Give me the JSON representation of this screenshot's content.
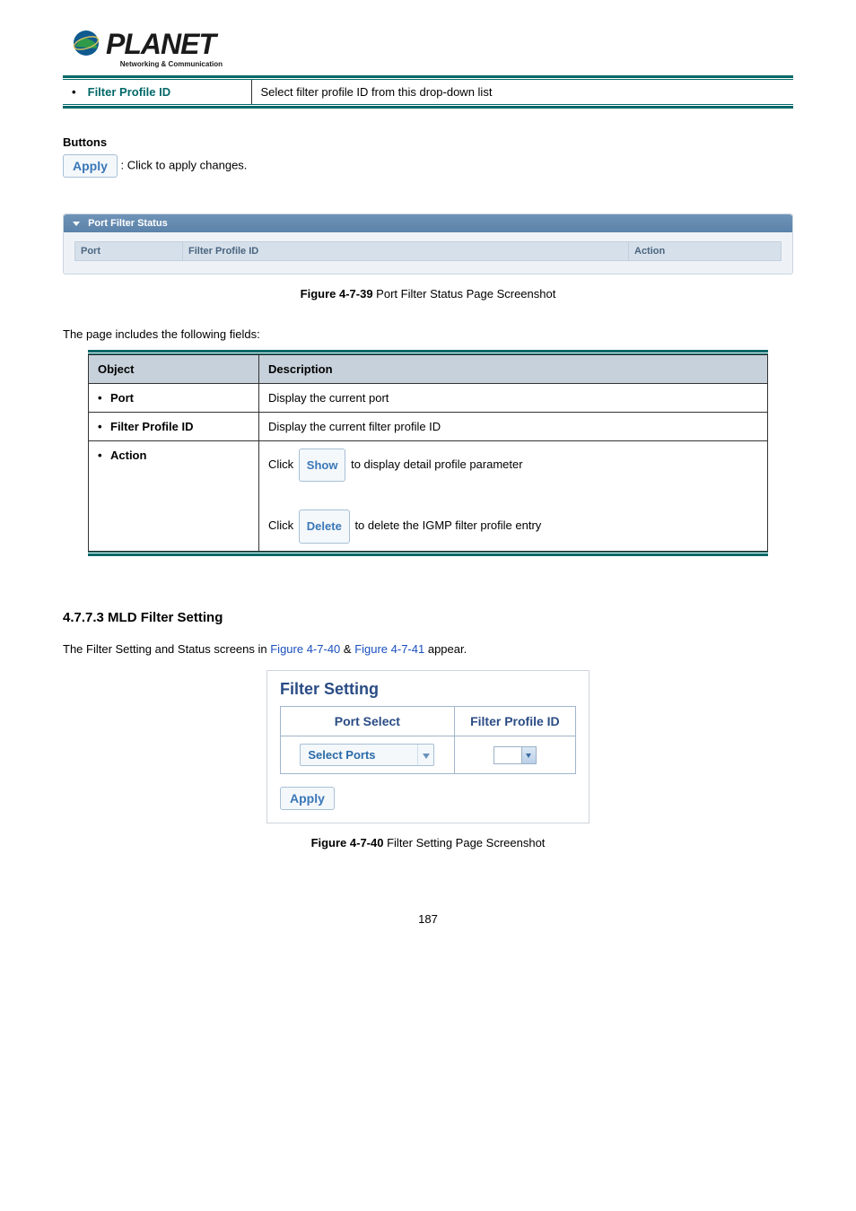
{
  "brand": {
    "name": "PLANET",
    "tagline": "Networking & Communication"
  },
  "param_row": {
    "object": "Filter Profile ID",
    "desc": "Select filter profile ID from this drop-down list"
  },
  "buttons_section": {
    "heading": "Buttons",
    "apply_label": "Apply",
    "apply_desc": ": Click to apply changes."
  },
  "panel": {
    "title": "Port Filter Status",
    "columns": {
      "port": "Port",
      "filter": "Filter Profile ID",
      "action": "Action"
    }
  },
  "fig39": {
    "label": "Figure 4-7-39",
    "caption": " Port Filter Status Page Screenshot"
  },
  "fields_intro": "The page includes the following fields:",
  "fields_table": {
    "head": {
      "obj": "Object",
      "desc": "Description"
    },
    "rows": {
      "port": {
        "obj": "Port",
        "desc": "Display the current port"
      },
      "filter": {
        "obj": "Filter Profile ID",
        "desc": "Display the current filter profile ID"
      },
      "action": {
        "obj": "Action",
        "click": "Click ",
        "show_btn": "Show",
        "show_tail": " to display detail profile parameter",
        "delete_btn": "Delete",
        "delete_tail": " to delete the IGMP filter profile entry"
      }
    }
  },
  "subsection": {
    "num": "4.7.7.3 ",
    "title": "MLD Filter Setting"
  },
  "subsection_text": {
    "pre": "The Filter Setting and Status screens in ",
    "link1": "Figure 4-7-40",
    "mid": " & ",
    "link2": "Figure 4-7-41",
    "post": " appear."
  },
  "filter_box": {
    "title": "Filter Setting",
    "th1": "Port Select",
    "th2": "Filter Profile ID",
    "select_label": "Select Ports",
    "apply_label": "Apply"
  },
  "fig40": {
    "label": "Figure 4-7-40",
    "caption": " Filter Setting Page Screenshot"
  },
  "page_number": "187",
  "chart_data": null
}
